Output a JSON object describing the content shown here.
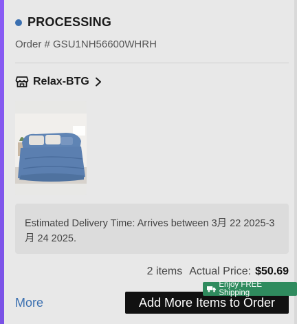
{
  "order": {
    "status": "PROCESSING",
    "order_number": "Order # GSU1NH56600WHRH"
  },
  "store": {
    "name": "Relax-BTG",
    "icon": "store-icon"
  },
  "product": {
    "image_icon": "bedding-set-image"
  },
  "delivery": {
    "text": "Estimated Delivery Time: Arrives between 3月 22 2025-3月 24 2025."
  },
  "summary": {
    "items_count": "2 items",
    "price_label": "Actual Price:",
    "price_value": "$50.69"
  },
  "actions": {
    "more_label": "More",
    "add_items_label": "Add More Items to Order",
    "shipping_badge": "Enjoy FREE Shipping"
  },
  "colors": {
    "accent_blue": "#3a6fb0",
    "badge_green": "#2f8b5e",
    "button_black": "#111111",
    "left_bar_purple": "#8a5cf5"
  }
}
